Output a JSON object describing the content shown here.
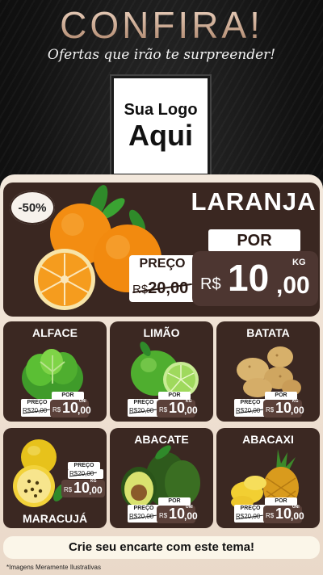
{
  "header": {
    "headline": "CONFIRA!",
    "tagline": "Ofertas que irão te surpreender!"
  },
  "logo": {
    "line1": "Sua Logo",
    "line2": "Aqui"
  },
  "hero": {
    "discount_badge": "-50%",
    "name": "LARANJA",
    "por_label": "POR",
    "preco_label": "PREÇO",
    "old_currency": "R$",
    "old_price": "20,00",
    "currency": "R$",
    "price_int": "10",
    "price_dec": ",00",
    "unit": "KG"
  },
  "products": [
    {
      "name": "ALFACE",
      "preco": "PREÇO",
      "por": "POR",
      "old": "R$20,00",
      "cur": "R$",
      "int": "10",
      "dec": ",00",
      "unit": "UNI"
    },
    {
      "name": "LIMÃO",
      "preco": "PREÇO",
      "por": "POR",
      "old": "R$20,00",
      "cur": "R$",
      "int": "10",
      "dec": ",00",
      "unit": "KG"
    },
    {
      "name": "BATATA",
      "preco": "PREÇO",
      "por": "POR",
      "old": "R$20,00",
      "cur": "R$",
      "int": "10",
      "dec": ",00",
      "unit": "KG"
    },
    {
      "name": "MARACUJÁ",
      "preco": "PREÇO",
      "por": "POR",
      "old": "R$20,00",
      "cur": "R$",
      "int": "10",
      "dec": ",00",
      "unit": "KG"
    },
    {
      "name": "ABACATE",
      "preco": "PREÇO",
      "por": "POR",
      "old": "R$20,00",
      "cur": "R$",
      "int": "10",
      "dec": ",00",
      "unit": "UNI"
    },
    {
      "name": "ABACAXI",
      "preco": "PREÇO",
      "por": "POR",
      "old": "R$20,00",
      "cur": "R$",
      "int": "10",
      "dec": ",00",
      "unit": "UNI"
    }
  ],
  "cta": "Crie seu encarte com este tema!",
  "footnote": "*Imagens Meramente Ilustrativas",
  "colors": {
    "card_bg": "#3b2822",
    "panel_bg": "#f3e8dc",
    "headline": "#d8b9a4"
  }
}
